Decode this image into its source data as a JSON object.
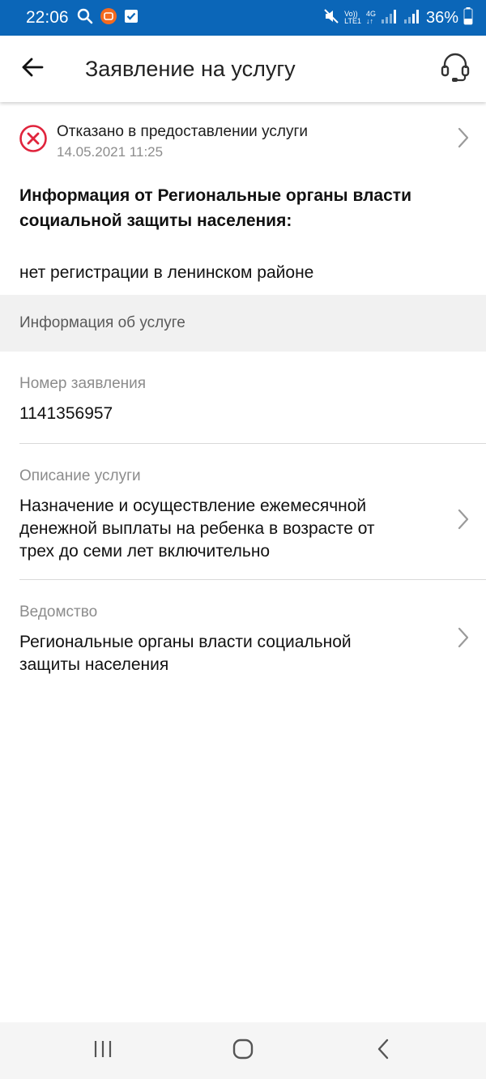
{
  "status_bar": {
    "time": "22:06",
    "volte_label": "Vo))",
    "lte_label": "LTE1",
    "net_label": "4G",
    "battery": "36%"
  },
  "header": {
    "title": "Заявление на услугу",
    "back_icon": "arrow-left-icon",
    "support_icon": "headset-icon"
  },
  "status": {
    "title": "Отказано в предоставлении услуги",
    "date": "14.05.2021 11:25",
    "color": "#e0243c"
  },
  "info": {
    "heading": "Информация от Региональные органы власти социальной защиты населения:",
    "message": "нет регистрации в ленинском районе"
  },
  "section": {
    "title": "Информация об услуге"
  },
  "fields": {
    "number": {
      "label": "Номер заявления",
      "value": "1141356957"
    },
    "description": {
      "label": "Описание услуги",
      "value": "Назначение и осуществление ежемесячной денежной выплаты на ребенка в возрасте от трех до семи лет включительно"
    },
    "department": {
      "label": "Ведомство",
      "value": "Региональные органы власти социальной защиты населения"
    }
  },
  "colors": {
    "status_bar": "#0b66b8",
    "accent_error": "#e0243c",
    "secondary_text": "#8c8c8c"
  }
}
